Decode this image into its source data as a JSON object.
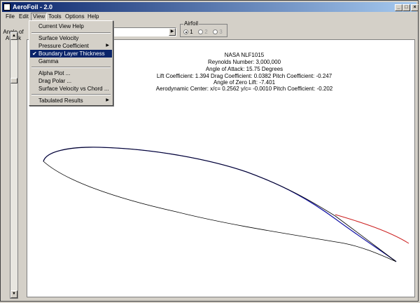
{
  "window": {
    "title": "AeroFoil - 2.0"
  },
  "title_buttons": {
    "minimize": "_",
    "maximize": "□",
    "close": "×"
  },
  "menubar": [
    "File",
    "Edit",
    "View",
    "Tools",
    "Options",
    "Help"
  ],
  "view_menu": {
    "items": [
      "Current View Help",
      "Surface Velocity",
      "Pressure Coefficient",
      "Boundary Layer Thickness",
      "Gamma",
      "Alpha Plot ...",
      "Drag Polar ...",
      "Surface Velocity vs Chord ...",
      "Tabulated Results"
    ],
    "checked": "Boundary Layer Thickness"
  },
  "angle_of_attack": {
    "label_line1": "Angle of",
    "label_line2": "Attack"
  },
  "airfoil_group": {
    "title": "Airfoil",
    "options": [
      "1",
      "2",
      "3"
    ],
    "selected": "1"
  },
  "info": {
    "line1": "NASA  NLF1015",
    "line2": "Reynolds Number: 3,000,000",
    "line3": "Angle of Attack: 15.75 Degrees",
    "line4": "Lift Coefficient: 1.394   Drag Coefficient: 0.0382   Pitch Coefficient: -0.247",
    "line5": "Angle of Zero Lift: -7.401",
    "line6": "Aerodynamic Center: x/c= 0.2562  y/c= -0.0010   Pitch Coefficient: -0.202"
  },
  "colors": {
    "airfoil": "#000000",
    "boundary_layer": "#1a1aa8",
    "wake": "#cc2020",
    "title_bar": "#0a246a",
    "menu_highlight": "#0a246a"
  }
}
